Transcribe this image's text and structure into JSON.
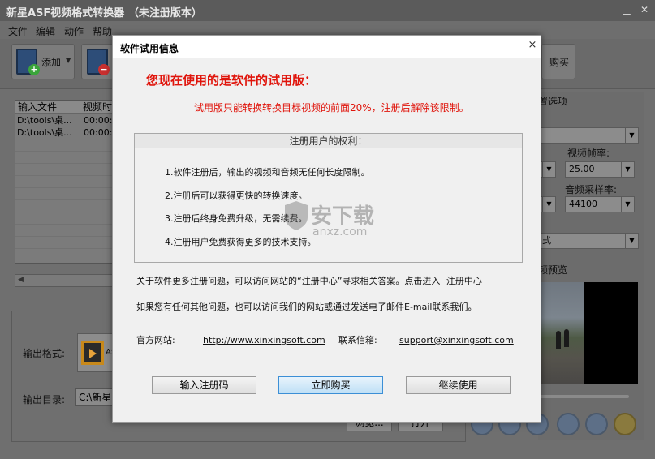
{
  "app": {
    "title": "新星ASF视频格式转换器 （未注册版本）",
    "menu": [
      "文件",
      "编辑",
      "动作",
      "帮助"
    ],
    "toolbar": {
      "add_label": "添加",
      "buy_label": "购买"
    },
    "file_list": {
      "columns": [
        "输入文件",
        "视频时"
      ],
      "rows": [
        {
          "file": "D:\\tools\\桌...",
          "time": "00:00:"
        },
        {
          "file": "D:\\tools\\桌...",
          "time": "00:00:"
        }
      ]
    },
    "right_panel": {
      "settings_title": "置选项",
      "video_fps_label": "视频帧率:",
      "video_fps_value": "25.00",
      "audio_rate_label": "音频采样率:",
      "audio_rate_value": "44100",
      "mode_value": "式",
      "preview_title": "频预览"
    },
    "bottom": {
      "output_format_label": "输出格式:",
      "output_format_value": "AS",
      "output_dir_label": "输出目录:",
      "output_dir_value": "C:\\新星",
      "browse_label": "浏览...",
      "open_label": "打开"
    }
  },
  "dialog": {
    "title": "软件试用信息",
    "close_glyph": "×",
    "heading": "您现在使用的是软件的试用版：",
    "subline": "试用版只能转换转换目标视频的前面20%，注册后解除该限制。",
    "rights_title": "注册用户的权利：",
    "rights": [
      "1.软件注册后，输出的视频和音频无任何长度限制。",
      "2.注册后可以获得更快的转换速度。",
      "3.注册后终身免费升级，无需续费。",
      "4.注册用户免费获得更多的技术支持。"
    ],
    "para1": "关于软件更多注册问题，可以访问网站的“注册中心”寻求相关答案。点击进入",
    "para1_link": "注册中心",
    "para2": "如果您有任何其他问题，也可以访问我们的网站或通过发送电子邮件E-mail联系我们。",
    "site_label": "官方网站:",
    "site_url": "http://www.xinxingsoft.com",
    "mail_label": "联系信箱:",
    "mail": "support@xinxingsoft.com",
    "buttons": {
      "enter_code": "输入注册码",
      "buy_now": "立即购买",
      "continue": "继续使用"
    },
    "watermark": {
      "text": "安下载",
      "sub": "anxz.com"
    }
  }
}
